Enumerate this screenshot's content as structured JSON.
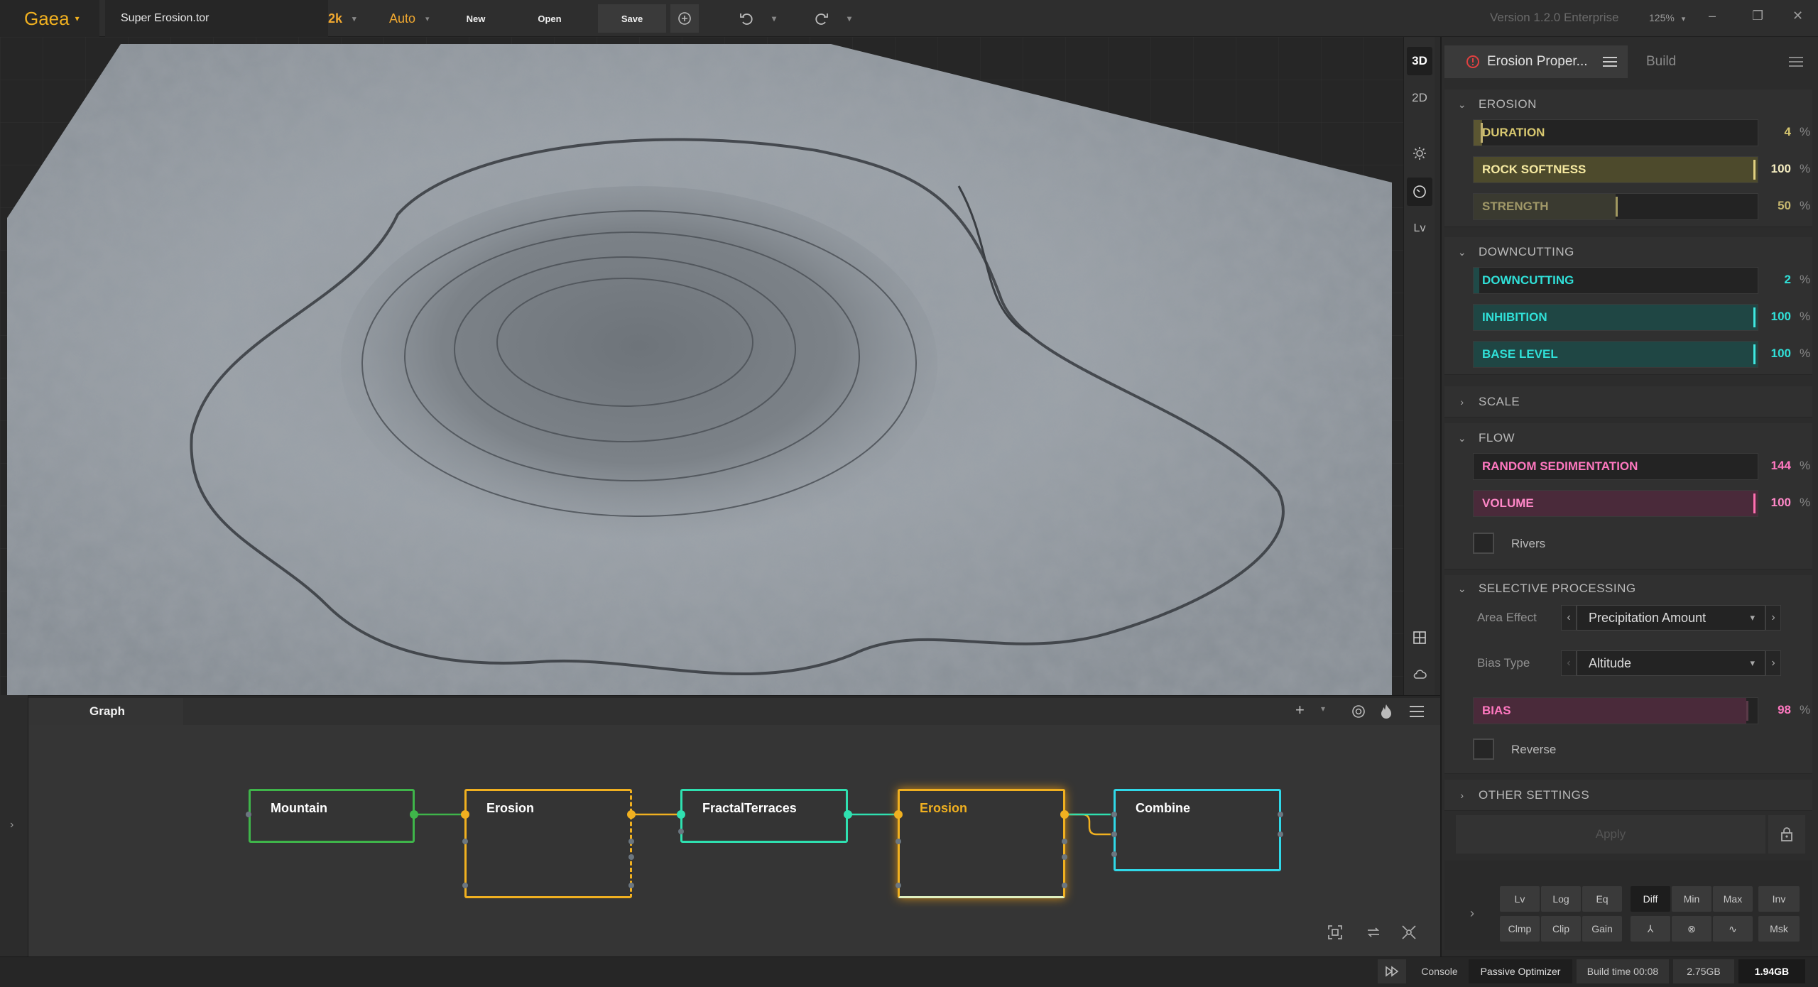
{
  "app": {
    "name": "Gaea",
    "file": "Super Erosion.tor",
    "resolution": "2k",
    "build_mode": "Auto",
    "version": "Version 1.2.0 Enterprise",
    "zoom": "125%"
  },
  "toolbar": {
    "new": "New",
    "open": "Open",
    "save": "Save"
  },
  "viewport_toolbar": {
    "mode_3d": "3D",
    "mode_2d": "2D",
    "lv": "Lv"
  },
  "graph": {
    "tab": "Graph",
    "nodes": [
      {
        "label": "Mountain",
        "color": "#3fb54a"
      },
      {
        "label": "Erosion",
        "color": "#f0b020"
      },
      {
        "label": "FractalTerraces",
        "color": "#2fe0b0"
      },
      {
        "label": "Erosion",
        "color": "#f0b020",
        "selected": true
      },
      {
        "label": "Combine",
        "color": "#30d8e8"
      }
    ]
  },
  "panel": {
    "tab_active": "Erosion Proper...",
    "tab_build": "Build",
    "sections": {
      "erosion": "EROSION",
      "downcutting": "DOWNCUTTING",
      "scale": "SCALE",
      "flow": "FLOW",
      "selective": "SELECTIVE PROCESSING",
      "other": "OTHER SETTINGS"
    },
    "params": {
      "duration": {
        "label": "DURATION",
        "value": "4",
        "unit": "%",
        "fraction": 0.04
      },
      "rock_softness": {
        "label": "ROCK SOFTNESS",
        "value": "100",
        "unit": "%",
        "fraction": 1.0
      },
      "strength": {
        "label": "STRENGTH",
        "value": "50",
        "unit": "%",
        "fraction": 0.5
      },
      "downcutting": {
        "label": "DOWNCUTTING",
        "value": "2",
        "unit": "%",
        "fraction": 0.02
      },
      "inhibition": {
        "label": "INHIBITION",
        "value": "100",
        "unit": "%",
        "fraction": 1.0
      },
      "base_level": {
        "label": "BASE LEVEL",
        "value": "100",
        "unit": "%",
        "fraction": 1.0
      },
      "random_sedimentation": {
        "label": "RANDOM SEDIMENTATION",
        "value": "144",
        "unit": "%",
        "fraction": 0.0
      },
      "volume": {
        "label": "VOLUME",
        "value": "100",
        "unit": "%",
        "fraction": 1.0
      },
      "bias": {
        "label": "BIAS",
        "value": "98",
        "unit": "%",
        "fraction": 0.98
      }
    },
    "rivers_label": "Rivers",
    "area_effect": {
      "label": "Area Effect",
      "value": "Precipitation Amount"
    },
    "bias_type": {
      "label": "Bias Type",
      "value": "Altitude"
    },
    "reverse_label": "Reverse",
    "apply": "Apply",
    "buttons_row1": [
      "Lv",
      "Log",
      "Eq",
      "Diff",
      "Min",
      "Max",
      "Inv"
    ],
    "buttons_row2": [
      "Clmp",
      "Clip",
      "Gain",
      "Msk"
    ],
    "active_button": "Diff"
  },
  "status": {
    "console": "Console",
    "optimizer": "Passive Optimizer",
    "build_time": "Build time 00:08",
    "mem1": "2.75GB",
    "mem2": "1.94GB"
  },
  "colors": {
    "accent": "#f0a830",
    "erosion_gold": "#d8c870",
    "downcutting_teal": "#30e0d8",
    "flow_pink": "#ff78c0"
  }
}
